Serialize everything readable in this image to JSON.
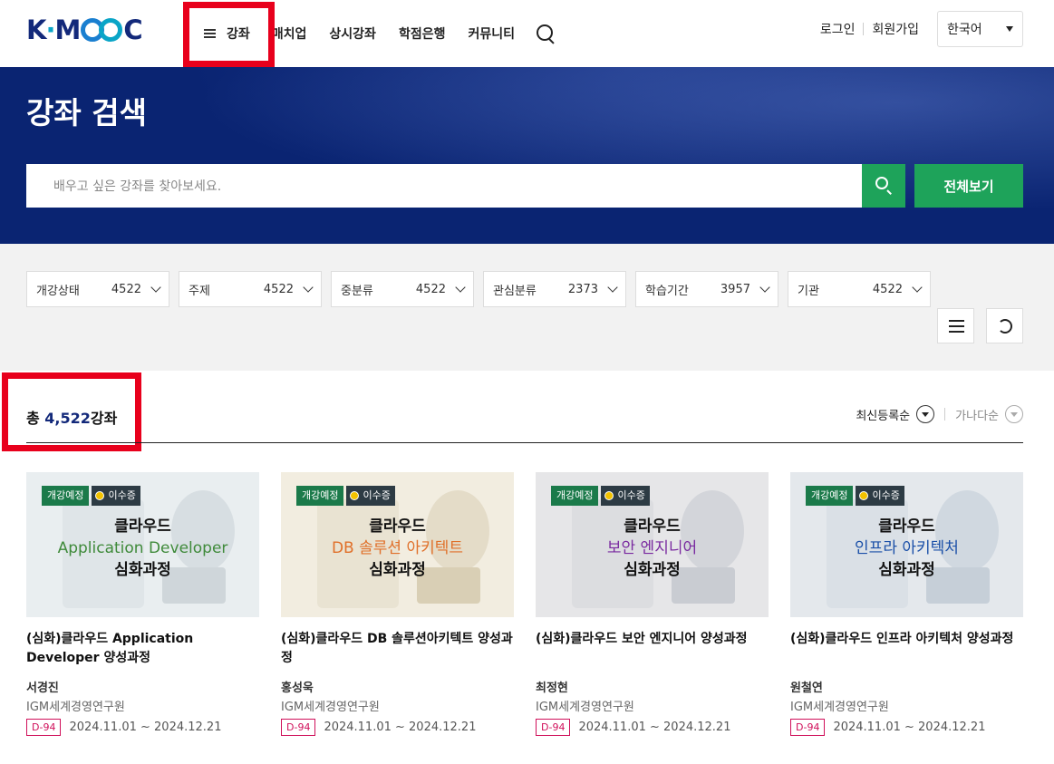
{
  "header": {
    "logo_text_1": "K",
    "logo_dot": "·",
    "logo_text_2": "M",
    "logo_text_3": "C",
    "nav": {
      "course": "강좌",
      "matchup": "매치업",
      "always_on": "상시강좌",
      "credit_bank": "학점은행",
      "community": "커뮤니티"
    },
    "login": "로그인",
    "signup": "회원가입",
    "language": "한국어"
  },
  "banner": {
    "title": "강좌 검색",
    "search_placeholder": "배우고 싶은 강좌를 찾아보세요.",
    "view_all": "전체보기"
  },
  "filters": [
    {
      "label": "개강상태",
      "count": "4522"
    },
    {
      "label": "주제",
      "count": "4522"
    },
    {
      "label": "중분류",
      "count": "4522"
    },
    {
      "label": "관심분류",
      "count": "2373"
    },
    {
      "label": "학습기간",
      "count": "3957"
    },
    {
      "label": "기관",
      "count": "4522"
    }
  ],
  "results": {
    "total_prefix": "총 ",
    "total_count": "4,522",
    "total_suffix": "강좌",
    "sort_latest": "최신등록순",
    "sort_alpha": "가나다순"
  },
  "colors": {
    "brand_navy": "#13297a",
    "accent_green": "#1ea35a",
    "highlight_red": "#e8001c",
    "dday_pink": "#d0105a"
  },
  "courses": [
    {
      "badge_open": "개강예정",
      "badge_cert": "이수증",
      "thumb_line1": "클라우드",
      "thumb_line2": "Application Developer",
      "thumb_line2_color": "#3f8a3a",
      "thumb_line3": "심화과정",
      "title": "(심화)클라우드 Application Developer 양성과정",
      "professor": "서경진",
      "org": "IGM세계경영연구원",
      "dday": "D-94",
      "period": "2024.11.01 ~ 2024.12.21"
    },
    {
      "badge_open": "개강예정",
      "badge_cert": "이수증",
      "thumb_line1": "클라우드",
      "thumb_line2": "DB 솔루션 아키텍트",
      "thumb_line2_color": "#e0702a",
      "thumb_line3": "심화과정",
      "title": "(심화)클라우드 DB 솔루션아키텍트 양성과정",
      "professor": "홍성욱",
      "org": "IGM세계경영연구원",
      "dday": "D-94",
      "period": "2024.11.01 ~ 2024.12.21"
    },
    {
      "badge_open": "개강예정",
      "badge_cert": "이수증",
      "thumb_line1": "클라우드",
      "thumb_line2": "보안 엔지니어",
      "thumb_line2_color": "#7a2aa0",
      "thumb_line3": "심화과정",
      "title": "(심화)클라우드 보안 엔지니어 양성과정",
      "professor": "최정현",
      "org": "IGM세계경영연구원",
      "dday": "D-94",
      "period": "2024.11.01 ~ 2024.12.21"
    },
    {
      "badge_open": "개강예정",
      "badge_cert": "이수증",
      "thumb_line1": "클라우드",
      "thumb_line2": "인프라 아키텍처",
      "thumb_line2_color": "#1a4fa8",
      "thumb_line3": "심화과정",
      "title": "(심화)클라우드 인프라 아키텍처 양성과정",
      "professor": "원철연",
      "org": "IGM세계경영연구원",
      "dday": "D-94",
      "period": "2024.11.01 ~ 2024.12.21"
    }
  ]
}
